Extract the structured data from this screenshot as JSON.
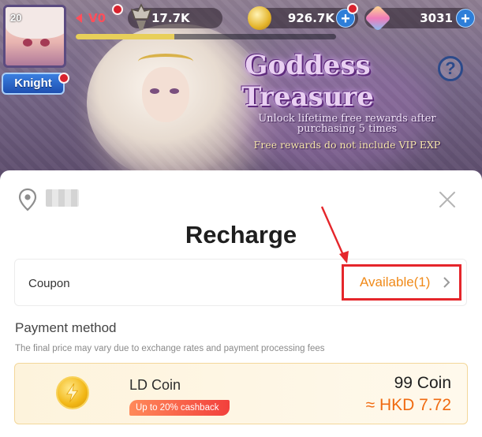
{
  "hud": {
    "level": "20",
    "vip": "V0",
    "power": "17.7K",
    "gold": "926.7K",
    "gems": "3031",
    "xp_progress": 0.38,
    "rank": "Knight"
  },
  "event": {
    "title_line1": "Goddess",
    "title_line2": "Treasure",
    "desc_line1": "Unlock lifetime free rewards after",
    "desc_line2": "purchasing 5 times",
    "note": "Free rewards do not include VIP EXP"
  },
  "recharge": {
    "title": "Recharge",
    "coupon_label": "Coupon",
    "coupon_status": "Available(1)",
    "payment_title": "Payment method",
    "payment_note": "The final price may vary due to exchange rates and payment processing fees",
    "method": {
      "name": "LD Coin",
      "badge": "Up to 20% cashback",
      "amount": "99 Coin",
      "price": "≈ HKD 7.72"
    }
  },
  "icons": {
    "help": "?",
    "plus": "+"
  },
  "colors": {
    "accent_orange": "#f08a19",
    "highlight_red": "#e5262b",
    "price_orange": "#f06a10"
  }
}
